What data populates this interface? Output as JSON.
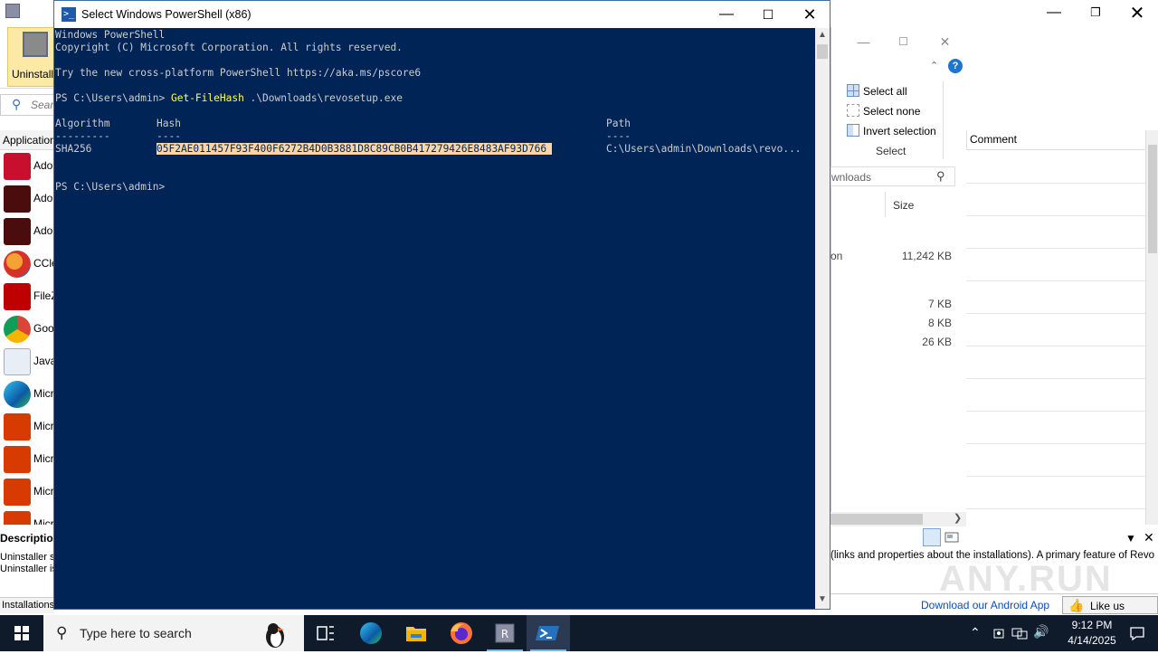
{
  "revo": {
    "uninstall_label": "Uninstall",
    "search_placeholder": "Search",
    "column_application": "Application",
    "apps": [
      "Ado",
      "Ado",
      "Ado",
      "CCle",
      "FileZ",
      "Goo",
      "Java",
      "Micr",
      "Micr",
      "Micr",
      "Micr",
      "Micr"
    ],
    "description_title": "Description",
    "description_text_1": "Uninstaller s",
    "description_text_2": "Uninstaller is",
    "installations_label": "Installations",
    "comment_column": "Comment",
    "description_right": "(links and properties about the installations). A primary feature of Revo",
    "android_link": "Download our Android App",
    "like_label": "Like us",
    "watermark": "ANY.RUN"
  },
  "explorer": {
    "select_all": "Select all",
    "select_none": "Select none",
    "invert_selection": "Invert selection",
    "select_group": "Select",
    "search_text": "wnloads",
    "size_column": "Size",
    "row1_name": "on",
    "sizes": [
      "11,242 KB",
      "7 KB",
      "8 KB",
      "26 KB"
    ]
  },
  "powershell": {
    "window_title": "Select Windows PowerShell (x86)",
    "lines": {
      "l1": "Windows PowerShell",
      "l2": "Copyright (C) Microsoft Corporation. All rights reserved.",
      "l3": "Try the new cross-platform PowerShell https://aka.ms/pscore6",
      "prompt1": "PS C:\\Users\\admin> ",
      "cmd": "Get-FileHash",
      "cmd_arg": " .\\Downloads\\revosetup.exe",
      "hdr_algorithm": "Algorithm",
      "hdr_hash": "Hash",
      "hdr_path": "Path",
      "dash_algorithm": "---------",
      "dash_hash": "----",
      "dash_path": "----",
      "algorithm": "SHA256",
      "hash": "05F2AE011457F93F400F6272B4D0B3881D8C89CB0B417279426E8483AF93D766",
      "path": "C:\\Users\\admin\\Downloads\\revo...",
      "prompt2": "PS C:\\Users\\admin>"
    }
  },
  "taskbar": {
    "search_placeholder": "Type here to search",
    "time": "9:12 PM",
    "date": "4/14/2025"
  },
  "colors": {
    "console_bg": "#012456",
    "console_text": "#cccccc",
    "command_yellow": "#ffff55",
    "selection": "#fbd7a8",
    "taskbar": "#0f1a2b"
  }
}
